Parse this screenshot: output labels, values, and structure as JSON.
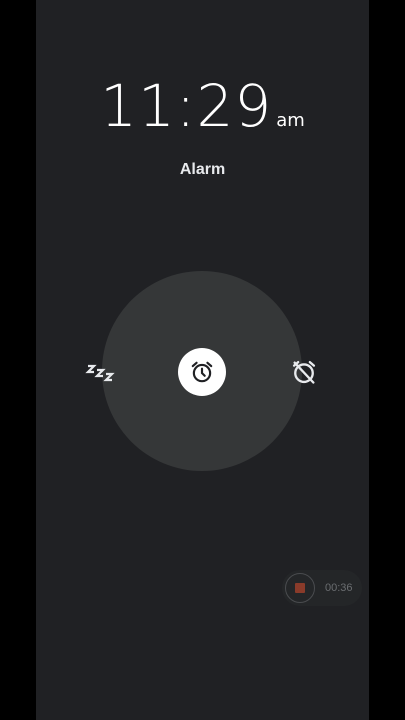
{
  "alarm": {
    "time": "11:29",
    "ampm": "am",
    "label": "Alarm"
  },
  "actions": {
    "snooze_icon": "snooze-zzz-icon",
    "center_icon": "alarm-clock-icon",
    "dismiss_icon": "alarm-off-icon"
  },
  "recorder": {
    "elapsed": "00:36",
    "icon": "stop-icon"
  },
  "colors": {
    "background": "#202124",
    "dial": "#353738",
    "text": "#ffffff",
    "record_stop": "#8a3b2a"
  }
}
